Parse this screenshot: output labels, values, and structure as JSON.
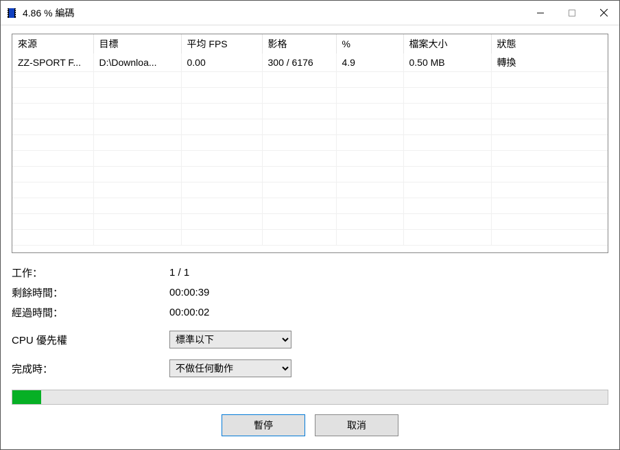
{
  "window": {
    "title": "4.86 % 編碼"
  },
  "table": {
    "headers": [
      "來源",
      "目標",
      "平均 FPS",
      "影格",
      "%",
      "檔案大小",
      "狀態"
    ],
    "rows": [
      {
        "source": "ZZ-SPORT F...",
        "target": "D:\\Downloa...",
        "fps": "0.00",
        "frames": "300 / 6176",
        "percent": "4.9",
        "filesize": "0.50 MB",
        "status": "轉換"
      }
    ]
  },
  "info": {
    "job_label": "工作：",
    "job_value": "1 / 1",
    "remaining_label": "剩餘時間：",
    "remaining_value": "00:00:39",
    "elapsed_label": "經過時間：",
    "elapsed_value": "00:00:02",
    "priority_label": "CPU 優先權",
    "priority_value": "標準以下",
    "when_done_label": "完成時：",
    "when_done_value": "不做任何動作"
  },
  "progress": {
    "percent": 4.86
  },
  "buttons": {
    "pause": "暫停",
    "cancel": "取消"
  }
}
